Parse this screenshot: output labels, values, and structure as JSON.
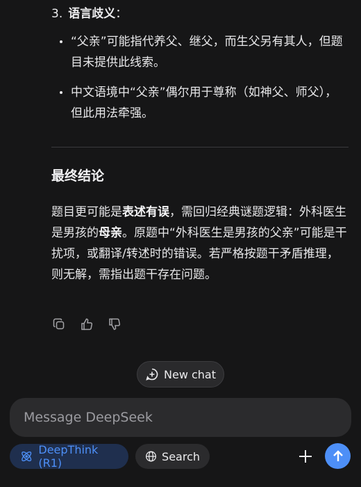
{
  "answer": {
    "item3": {
      "number": "3.",
      "title": "语言歧义",
      "colon": "："
    },
    "bullets": [
      "“父亲”可能指代养父、继父，而生父另有其人，但题目未提供此线索。",
      "中文语境中“父亲”偶尔用于尊称（如神父、师父），但此用法牵强。"
    ],
    "conclusion_heading": "最终结论",
    "conclusion": {
      "p1": "题目更可能是",
      "b1": "表述有误",
      "p2": "，需回归经典谜题逻辑：外科医生是男孩的",
      "b2": "母亲",
      "p3": "。原题中“外科医生是男孩的父亲”可能是干扰项，或翻译/转述时的错误。若严格按题干矛盾推理，则无解，需指出题干存在问题。"
    }
  },
  "actions": {
    "copy_icon": "copy-icon",
    "like_icon": "thumbs-up-icon",
    "dislike_icon": "thumbs-down-icon"
  },
  "new_chat": {
    "label": "New chat"
  },
  "composer": {
    "placeholder": "Message DeepSeek"
  },
  "toolbar": {
    "deepthink_label": "DeepThink (R1)",
    "search_label": "Search"
  },
  "colors": {
    "background": "#161617",
    "accent": "#4d8ff7",
    "deepthink_bg": "#1f2f4e"
  }
}
